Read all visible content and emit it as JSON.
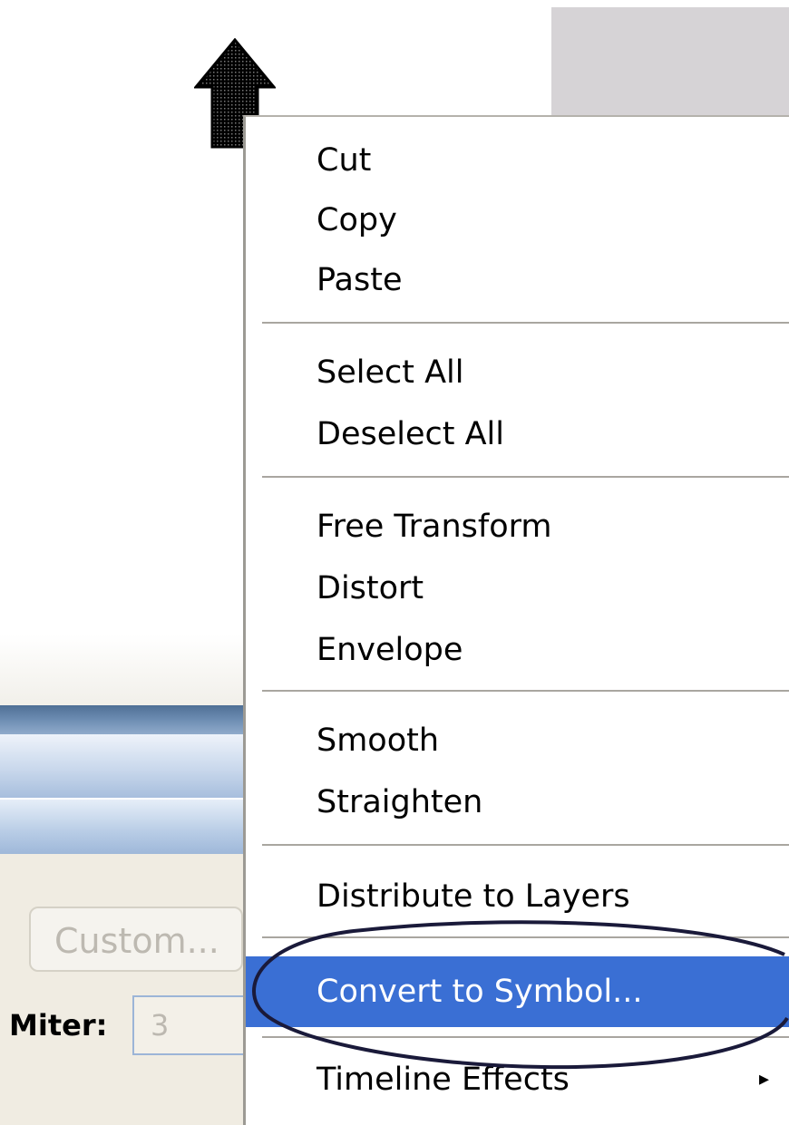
{
  "menu": {
    "items": [
      {
        "label": "Cut"
      },
      {
        "label": "Copy"
      },
      {
        "label": "Paste"
      },
      {
        "label": "Select All"
      },
      {
        "label": "Deselect All"
      },
      {
        "label": "Free Transform"
      },
      {
        "label": "Distort"
      },
      {
        "label": "Envelope"
      },
      {
        "label": "Smooth"
      },
      {
        "label": "Straighten"
      },
      {
        "label": "Distribute to Layers"
      },
      {
        "label": "Convert to Symbol..."
      },
      {
        "label": "Timeline Effects"
      }
    ],
    "highlighted_item": "Convert to Symbol...",
    "submenu_arrow": "▸"
  },
  "properties_panel": {
    "custom_button_label": "Custom...",
    "miter_label": "Miter:",
    "miter_value": "3"
  },
  "colors": {
    "highlight": "#3a6fd4",
    "stage_gray": "#d6d3d6",
    "panel_bg": "#f0ece2",
    "annotation": "#1a1a3a"
  },
  "icons": {
    "cursor": "arrow-cursor-icon",
    "submenu": "submenu-arrow-icon"
  }
}
